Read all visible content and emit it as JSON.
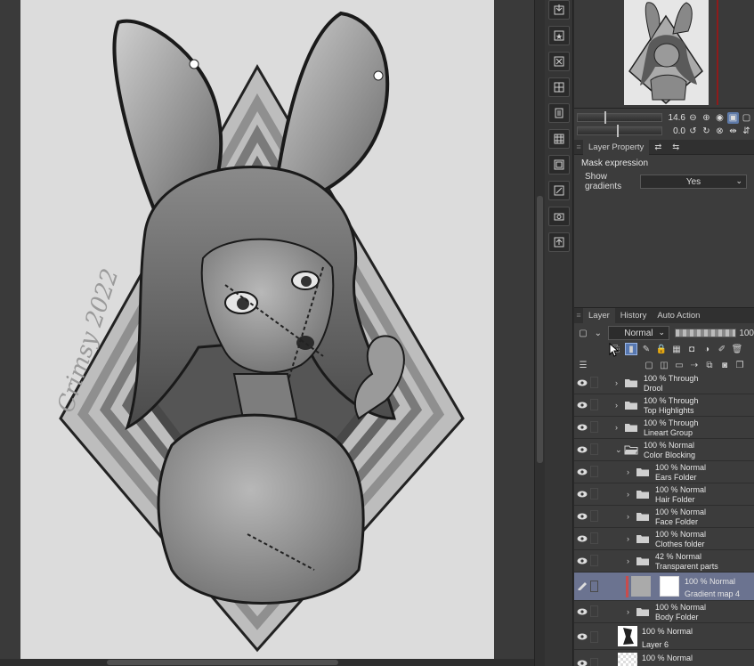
{
  "canvas": {
    "signature": "Crimsy 2022"
  },
  "tools": [
    {
      "icon": "import-icon"
    },
    {
      "icon": "star-icon"
    },
    {
      "icon": "x-icon"
    },
    {
      "icon": "grid-icon"
    },
    {
      "icon": "document-icon"
    },
    {
      "icon": "grid-icon"
    },
    {
      "icon": "frame-icon"
    },
    {
      "icon": "edit-icon"
    },
    {
      "icon": "camera-icon"
    },
    {
      "icon": "export-icon"
    }
  ],
  "navigator": {
    "zoom_value": "14.6",
    "rotate_value": "0.0"
  },
  "layer_property": {
    "tab_label": "Layer Property",
    "section_title": "Mask expression",
    "show_gradients_label": "Show gradients",
    "show_gradients_value": "Yes"
  },
  "layer_panel": {
    "tabs": [
      "Layer",
      "History",
      "Auto Action"
    ],
    "blend_mode": "Normal",
    "opacity": "100"
  },
  "layers": [
    {
      "pct": "100 % Through",
      "name": "Drool",
      "kind": "folder",
      "indent": 0
    },
    {
      "pct": "100 % Through",
      "name": "Top Highlights",
      "kind": "folder",
      "indent": 0
    },
    {
      "pct": "100 % Through",
      "name": "Lineart Group",
      "kind": "folder",
      "indent": 0
    },
    {
      "pct": "100 % Normal",
      "name": "Color Blocking",
      "kind": "folder-open",
      "indent": 0
    },
    {
      "pct": "100 % Normal",
      "name": "Ears Folder",
      "kind": "folder",
      "indent": 1
    },
    {
      "pct": "100 % Normal",
      "name": "Hair Folder",
      "kind": "folder",
      "indent": 1
    },
    {
      "pct": "100 % Normal",
      "name": "Face Folder",
      "kind": "folder",
      "indent": 1
    },
    {
      "pct": "100 % Normal",
      "name": "Clothes folder",
      "kind": "folder",
      "indent": 1
    },
    {
      "pct": "42 % Normal",
      "name": "Transparent parts",
      "kind": "folder",
      "indent": 1
    },
    {
      "pct": "100 % Normal",
      "name": "Gradient map 4",
      "kind": "gradient",
      "indent": 1
    },
    {
      "pct": "100 % Normal",
      "name": "Body Folder",
      "kind": "folder",
      "indent": 1
    },
    {
      "pct": "100 % Normal",
      "name": "Layer 6",
      "kind": "raster",
      "indent": 0
    },
    {
      "pct": "100 % Normal",
      "name": "",
      "kind": "raster",
      "indent": 0
    }
  ]
}
